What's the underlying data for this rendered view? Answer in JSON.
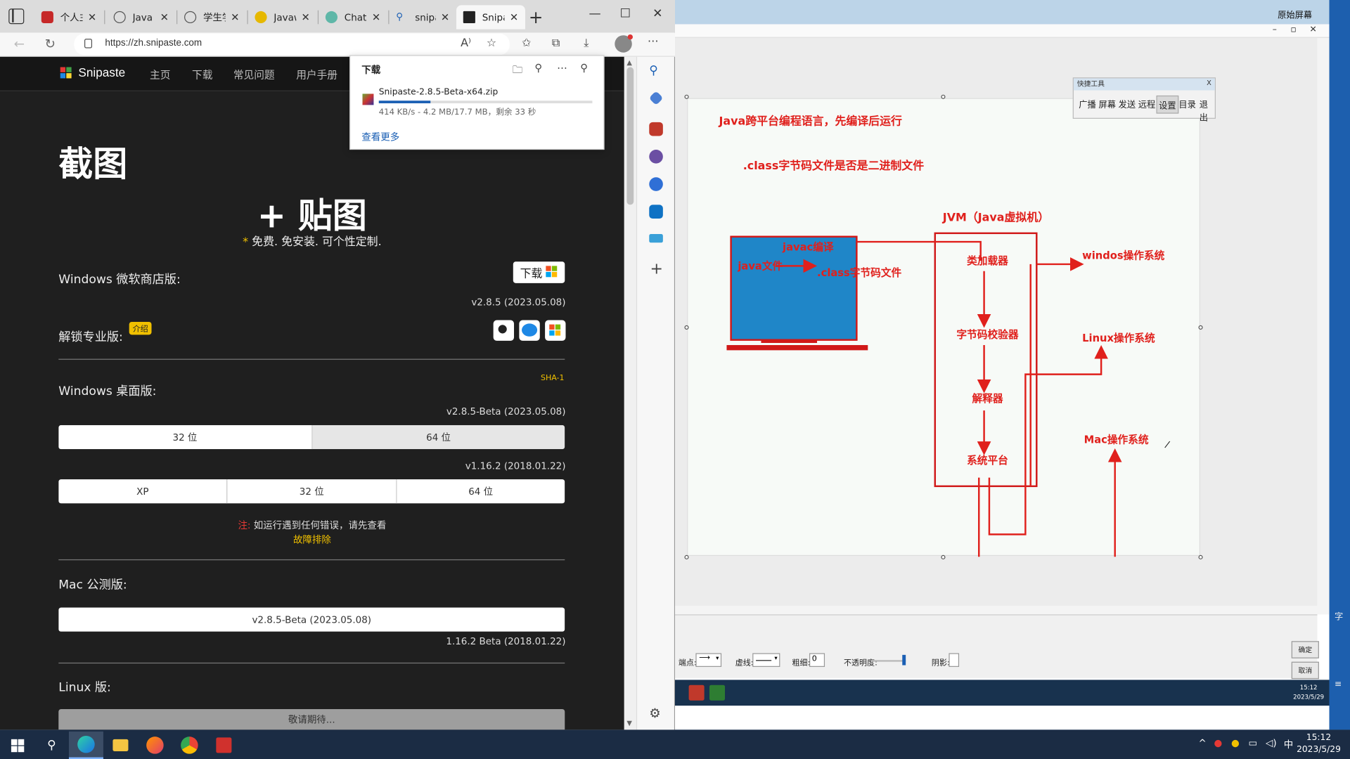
{
  "browser": {
    "tabs": [
      {
        "label": "个人主页",
        "color": "#c62828"
      },
      {
        "label": "Java Web",
        "color": "#555555"
      },
      {
        "label": "学生学习",
        "color": "#555555"
      },
      {
        "label": "Javaweb",
        "color": "#e6b800"
      },
      {
        "label": "ChatGPT",
        "color": "#5fb7a8"
      },
      {
        "label": "snipaste",
        "color": "#1a5fb4"
      },
      {
        "label": "Snipaste",
        "color": "#222222"
      }
    ],
    "url": "https://zh.snipaste.com",
    "win_min": "—",
    "win_max": "☐",
    "win_close": "✕"
  },
  "site": {
    "name": "Snipaste",
    "nav": [
      "主页",
      "下载",
      "常见问题",
      "用户手册"
    ],
    "hero_title": "截图",
    "hero_subtitle": "+ 贴图",
    "tagline_star": "*",
    "tagline": "免费. 免安装. 可个性定制.",
    "store_title": "Windows 微软商店版:",
    "store_button": "下载",
    "store_version": "v2.8.5 (2023.05.08)",
    "pro_title": "解锁专业版:",
    "pro_badge": "介绍",
    "sha_label": "SHA-1",
    "desktop_title": "Windows 桌面版:",
    "desktop_beta_version": "v2.8.5-Beta (2023.05.08)",
    "desktop_beta_buttons": [
      "32 位",
      "64 位"
    ],
    "desktop_old_version": "v1.16.2 (2018.01.22)",
    "desktop_old_buttons": [
      "XP",
      "32 位",
      "64 位"
    ],
    "note_label": "注:",
    "note_text": "如运行遇到任何错误，请先查看",
    "note_link": "故障排除",
    "mac_title": "Mac 公测版:",
    "mac_button": "v2.8.5-Beta (2023.05.08)",
    "mac_old_version": "1.16.2 Beta (2018.01.22)",
    "linux_title": "Linux 版:",
    "linux_button": "敬请期待..."
  },
  "downloads": {
    "title": "下载",
    "file_name": "Snipaste-2.8.5-Beta-x64.zip",
    "status": "414 KB/s - 4.2 MB/17.7 MB，剩余 33 秒",
    "progress": 0.24,
    "see_more": "查看更多"
  },
  "remote": {
    "title": "原始屏幕",
    "quick_tools_title": "快捷工具",
    "quick_tools": [
      "广播",
      "屏幕",
      "发送",
      "远程",
      "设置",
      "目录",
      "退出"
    ],
    "quick_tools_selected": "设置",
    "options": {
      "endpoint_label": "端点:",
      "line_label": "虚线:",
      "width_label": "粗细:",
      "width_value": "0",
      "opacity_label": "不透明度:",
      "shadow_label": "阴影:"
    },
    "ok_button": "确定",
    "cancel_button": "取消",
    "inner_clock_time": "15:12",
    "inner_clock_date": "2023/5/29"
  },
  "diagram": {
    "title": "Java跨平台编程语言，先编译后运行",
    "note": ".class字节码文件是否是二进制文件",
    "jvm_label": "JVM（Java虚拟机）",
    "java_file": "java文件",
    "javac": "javac编译",
    "class_file": ".class字节码文件",
    "class_loader": "类加载器",
    "bytecode_verifier": "字节码校验器",
    "interpreter": "解释器",
    "system_platform": "系统平台",
    "windows": "windos操作系统",
    "linux": "Linux操作系统",
    "mac": "Mac操作系统"
  },
  "taskbar": {
    "time": "15:12",
    "date": "2023/5/29",
    "ime": "中"
  }
}
